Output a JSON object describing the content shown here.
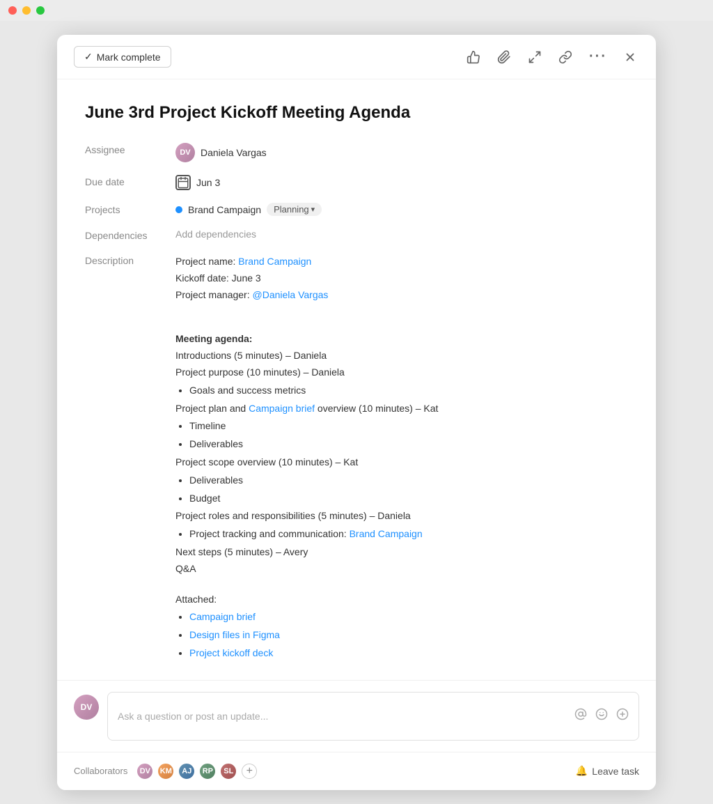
{
  "titlebar": {
    "controls": [
      "close",
      "minimize",
      "maximize"
    ]
  },
  "header": {
    "mark_complete_label": "Mark complete",
    "checkmark": "✓",
    "icons": {
      "thumbsup": "👍",
      "paperclip": "📎",
      "share": "⤴",
      "link": "🔗",
      "more": "···",
      "close": "✕"
    }
  },
  "task": {
    "title": "June 3rd Project Kickoff Meeting Agenda",
    "assignee_label": "Assignee",
    "assignee_name": "Daniela Vargas",
    "due_date_label": "Due date",
    "due_date": "Jun 3",
    "projects_label": "Projects",
    "project_name": "Brand Campaign",
    "project_status": "Planning",
    "dependencies_label": "Dependencies",
    "add_dependencies": "Add dependencies",
    "description_label": "Description",
    "description": {
      "project_name_label": "Project name: ",
      "project_name_link": "Brand Campaign",
      "kickoff_date": "Kickoff date: June 3",
      "project_manager_label": "Project manager: ",
      "project_manager_link": "@Daniela Vargas",
      "meeting_agenda_heading": "Meeting agenda:",
      "agenda_items": [
        "Introductions (5 minutes) – Daniela",
        "Project purpose (10 minutes) – Daniela"
      ],
      "agenda_sub1": [
        "Goals and success metrics"
      ],
      "agenda_plan_prefix": "Project plan and ",
      "agenda_plan_link": "Campaign brief",
      "agenda_plan_suffix": " overview (10 minutes) – Kat",
      "agenda_sub2": [
        "Timeline",
        "Deliverables"
      ],
      "agenda_scope": "Project scope overview (10 minutes) – Kat",
      "agenda_sub3": [
        "Deliverables",
        "Budget"
      ],
      "agenda_roles": "Project roles and responsibilities (5 minutes) – Daniela",
      "agenda_sub4_prefix": "Project tracking and communication: ",
      "agenda_sub4_link": "Brand Campaign",
      "agenda_next_steps": "Next steps (5 minutes) – Avery",
      "agenda_qa": "Q&A",
      "attached_heading": "Attached:",
      "attached_links": [
        "Campaign brief",
        "Design files in Figma",
        "Project kickoff deck"
      ]
    }
  },
  "comment": {
    "placeholder": "Ask a question or post an update...",
    "avatar_initials": "DV"
  },
  "collaborators": {
    "label": "Collaborators",
    "add_label": "+",
    "leave_task_label": "Leave task",
    "bell_icon": "🔔",
    "avatars": [
      {
        "initials": "DV",
        "color": "#c9a0dc"
      },
      {
        "initials": "KM",
        "color": "#f4a460"
      },
      {
        "initials": "AJ",
        "color": "#87ceeb"
      },
      {
        "initials": "RP",
        "color": "#90ee90"
      },
      {
        "initials": "SL",
        "color": "#f08080"
      }
    ]
  }
}
